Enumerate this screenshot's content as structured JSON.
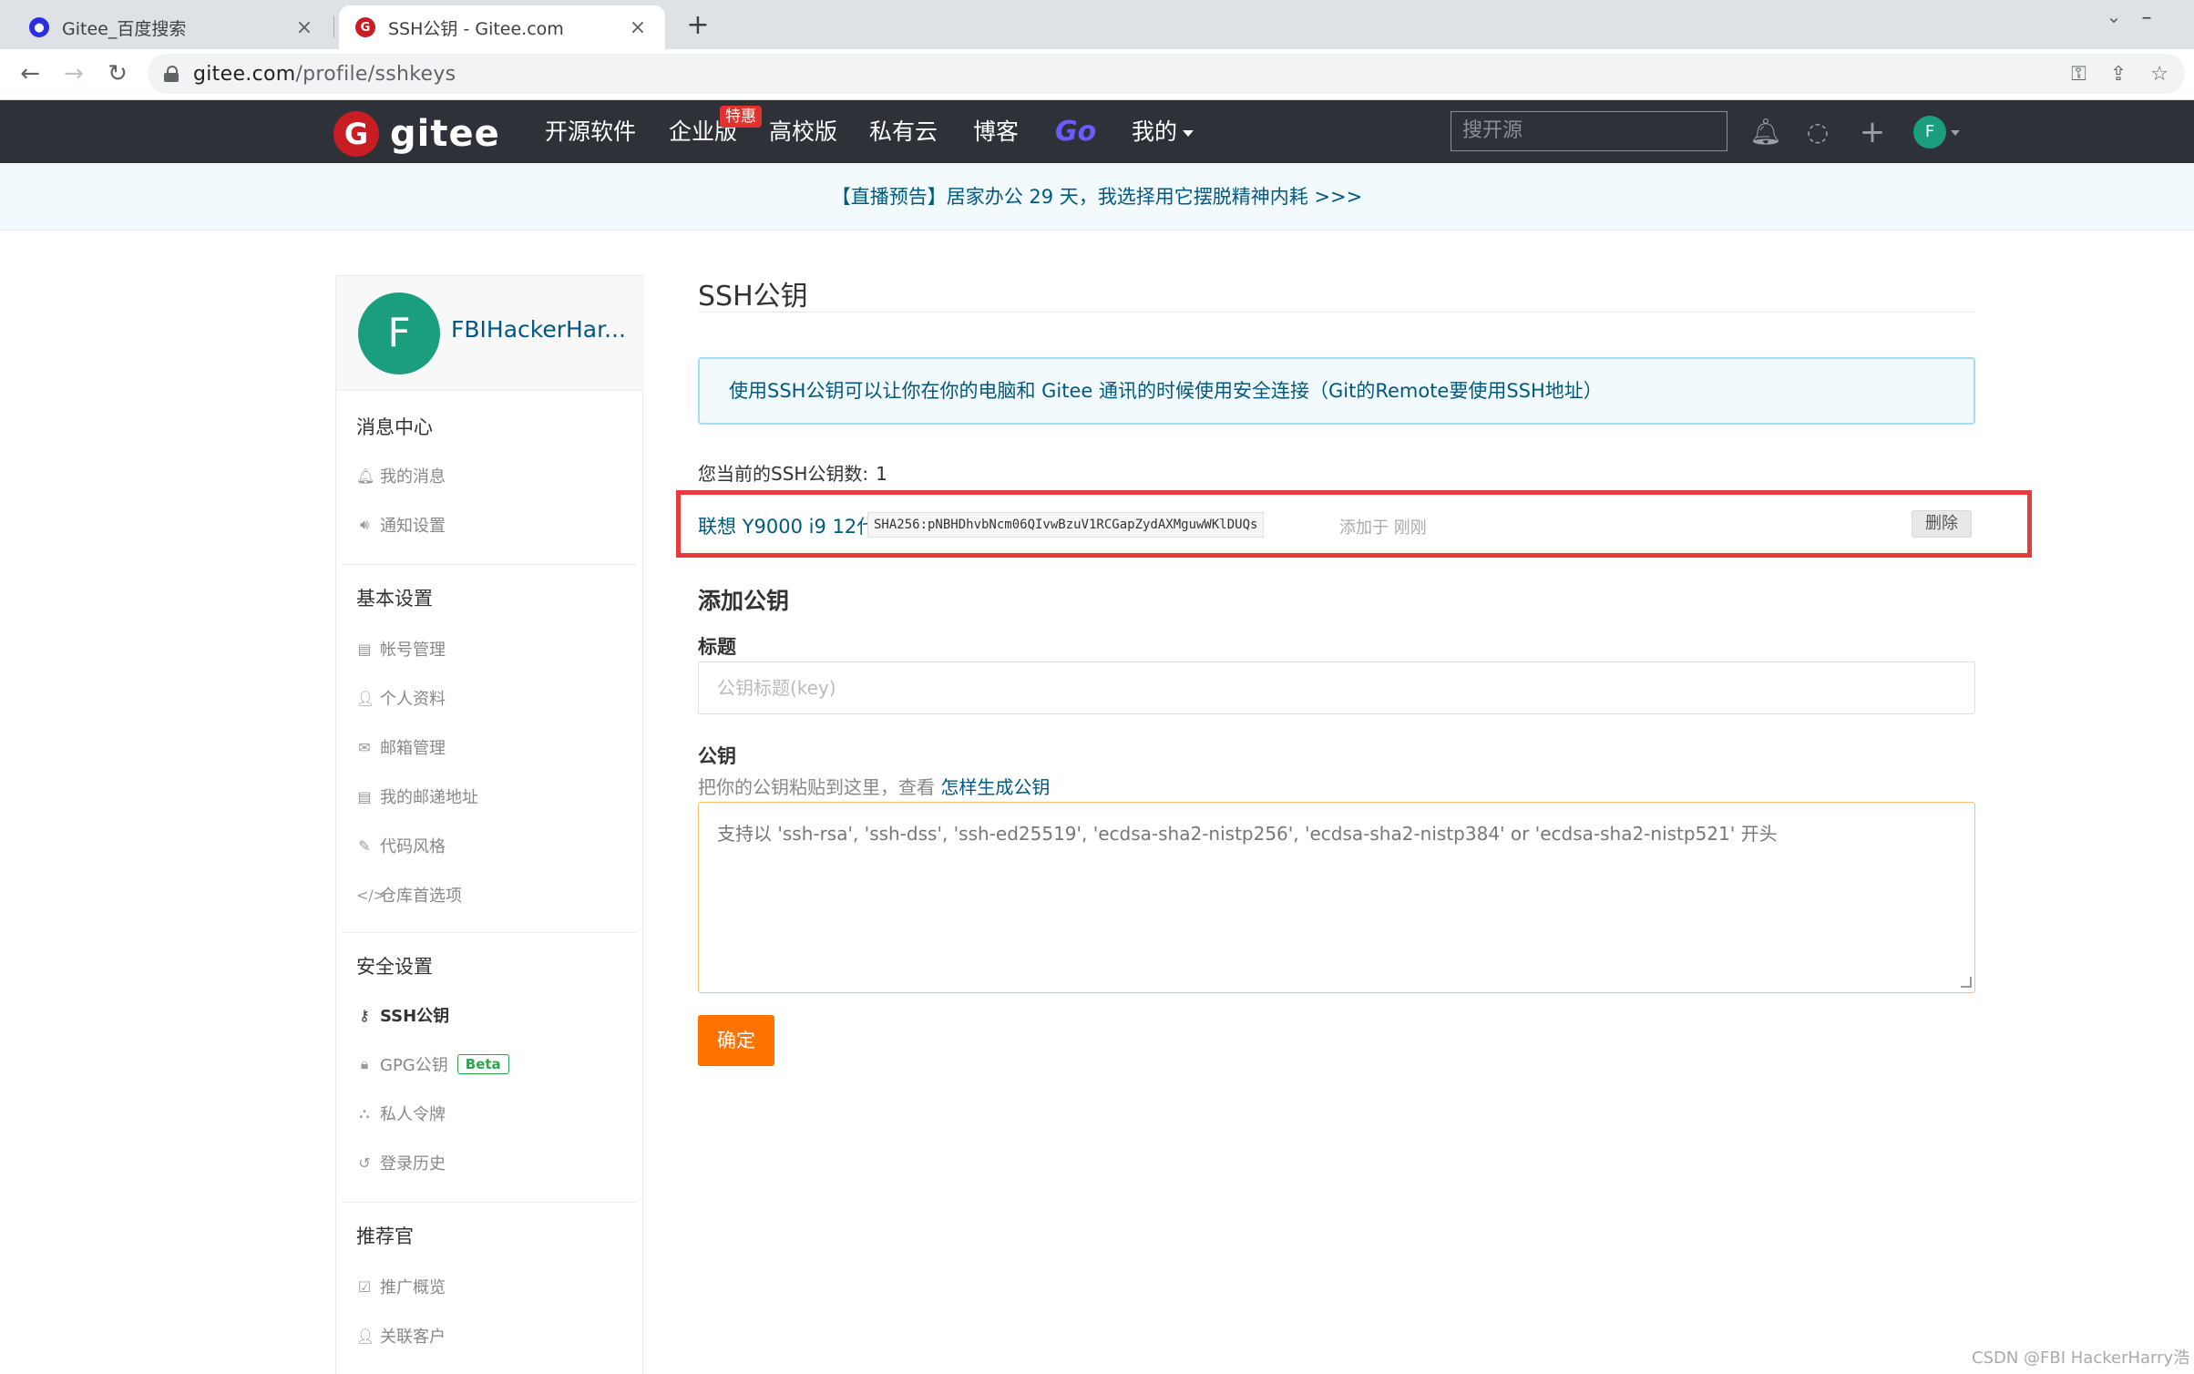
{
  "browser": {
    "tabs": [
      {
        "title": "Gitee_百度搜索",
        "favicon": "baidu-paw-icon"
      },
      {
        "title": "SSH公钥 - Gitee.com",
        "favicon": "gitee-logo-icon"
      }
    ],
    "new_tab_glyph": "+",
    "close_glyph": "×",
    "url_host": "gitee.com",
    "url_path": "/profile/sshkeys"
  },
  "header": {
    "logo_text": "gitee",
    "nav": [
      "开源软件",
      "企业版",
      "高校版",
      "私有云",
      "博客",
      "Go",
      "我的"
    ],
    "promo_badge": "特惠",
    "search_placeholder": "搜开源",
    "avatar_letter": "F"
  },
  "announcement": "【直播预告】居家办公 29 天，我选择用它摆脱精神内耗 >>>",
  "sidebar": {
    "avatar_letter": "F",
    "username": "FBIHackerHar...",
    "sections": [
      {
        "title": "消息中心",
        "items": [
          "我的消息",
          "通知设置"
        ]
      },
      {
        "title": "基本设置",
        "items": [
          "帐号管理",
          "个人资料",
          "邮箱管理",
          "我的邮递地址",
          "代码风格",
          "仓库首选项"
        ]
      },
      {
        "title": "安全设置",
        "items": [
          "SSH公钥",
          "GPG公钥",
          "私人令牌",
          "登录历史"
        ]
      },
      {
        "title": "推荐官",
        "items": [
          "推广概览",
          "关联客户"
        ]
      }
    ],
    "beta_badge": "Beta",
    "active_item": "SSH公钥"
  },
  "main": {
    "title": "SSH公钥",
    "info": "使用SSH公钥可以让你在你的电脑和 Gitee 通讯的时候使用安全连接（Git的Remote要使用SSH地址）",
    "count_label": "您当前的SSH公钥数:",
    "count_value": "1",
    "keys": [
      {
        "name": "联想 Y9000 i9 12代",
        "fingerprint": "SHA256:pNBHDhvbNcm06QIvwBzuV1RCGapZydAXMguwWKlDUQs",
        "added": "添加于 刚刚",
        "delete_label": "删除"
      }
    ],
    "add_heading": "添加公钥",
    "title_label": "标题",
    "title_placeholder": "公钥标题(key)",
    "key_label": "公钥",
    "key_hint": "把你的公钥粘贴到这里，查看",
    "key_hint_link": "怎样生成公钥",
    "key_placeholder": "支持以 'ssh-rsa', 'ssh-dss', 'ssh-ed25519', 'ecdsa-sha2-nistp256', 'ecdsa-sha2-nistp384' or 'ecdsa-sha2-nistp521' 开头",
    "submit_label": "确定"
  },
  "watermark": "CSDN @FBI HackerHarry浩",
  "colors": {
    "header_bg": "#2e3238",
    "brand_red": "#c71d23",
    "link_blue": "#005980",
    "highlight_red": "#e83a3c",
    "submit_orange": "#fe7300",
    "avatar_green": "#1a9e7e"
  }
}
